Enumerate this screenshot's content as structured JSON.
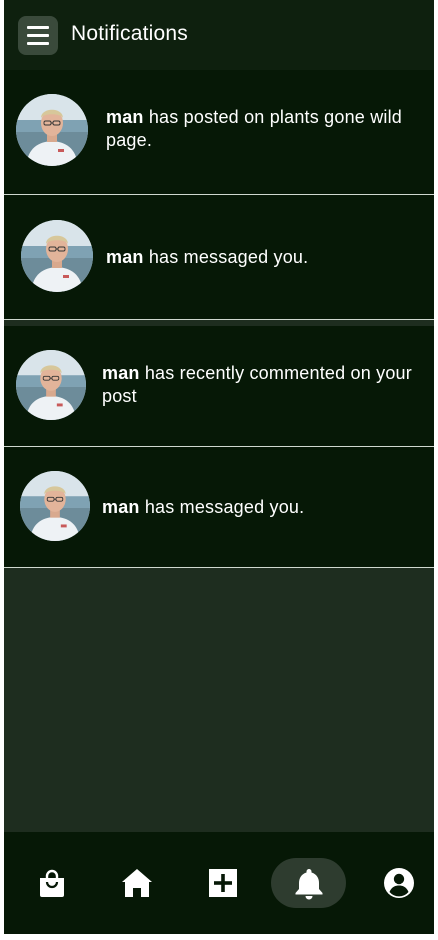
{
  "header": {
    "title": "Notifications",
    "menu_icon": "hamburger-menu-icon"
  },
  "notifications": [
    {
      "user": "man",
      "message": " has posted on plants gone wild page."
    },
    {
      "user": "man",
      "message": " has messaged you."
    },
    {
      "user": "man",
      "message": " has recently commented on your post"
    },
    {
      "user": "man",
      "message": " has messaged you."
    }
  ],
  "bottom_nav": {
    "items": [
      {
        "icon": "shopping-bag-icon",
        "active": false
      },
      {
        "icon": "home-icon",
        "active": false
      },
      {
        "icon": "add-square-icon",
        "active": false
      },
      {
        "icon": "bell-icon",
        "active": true
      },
      {
        "icon": "account-icon",
        "active": false
      }
    ]
  },
  "colors": {
    "background": "#1e2d1f",
    "header": "#0e200e",
    "card": "#061806",
    "active_nav": "#2e3c2f",
    "text": "#ffffff"
  }
}
